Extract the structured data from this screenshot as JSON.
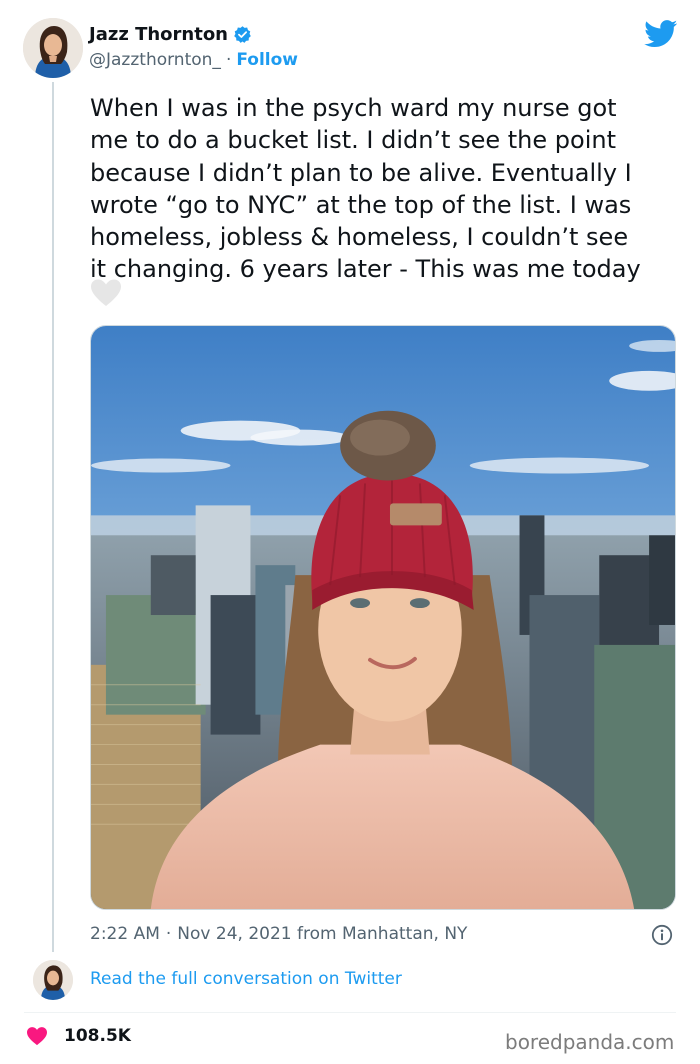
{
  "tweet": {
    "author": {
      "display_name": "Jazz Thornton",
      "handle": "@Jazzthornton_",
      "separator": "·",
      "follow_label": "Follow",
      "verified": true
    },
    "text": "When I was in the psych ward my nurse got\nme to do a bucket list. I didn’t see the point\nbecause I didn’t plan to be alive. Eventually I\nwrote “go to NYC” at the top of the list. I was\nhomeless, jobless & homeless, I couldn’t see\nit changing. 6 years later - This was me today",
    "emoji": "white-heart-icon",
    "time": "2:22 AM",
    "meta_separator": "·",
    "date": "Nov 24, 2021 from Manhattan, NY",
    "read_link": "Read the full conversation on Twitter",
    "likes": "108.5K"
  },
  "brand": {
    "watermark": "boredpanda.com"
  },
  "colors": {
    "accent": "#1d9bf0",
    "like": "#f91880",
    "text": "#0f1419",
    "secondary_text": "#536471"
  },
  "icons": [
    "verified-badge-icon",
    "twitter-bird-icon",
    "info-icon",
    "heart-icon",
    "white-heart-icon"
  ]
}
